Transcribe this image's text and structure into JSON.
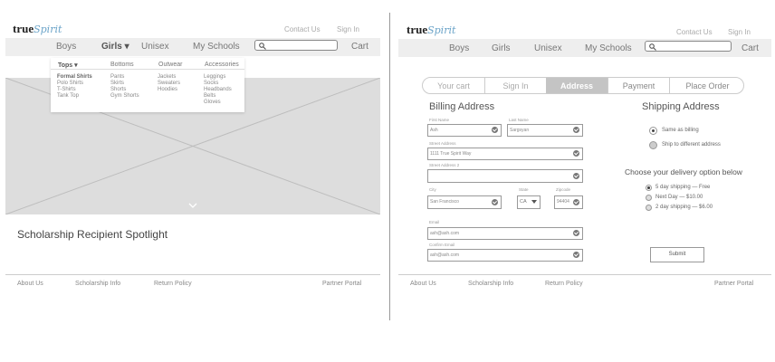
{
  "left": {
    "brand": {
      "word": "true",
      "script": "Spirit"
    },
    "top_links": {
      "contact": "Contact Us",
      "signin": "Sign In"
    },
    "nav": {
      "boys": "Boys",
      "girls": "Girls ▾",
      "unisex": "Unisex",
      "schools": "My Schools",
      "cart": "Cart"
    },
    "dropdown": {
      "headers": [
        "Tops  ▾",
        "Bottoms",
        "Outwear",
        "Accessories"
      ],
      "tops": [
        "Formal Shirts",
        "Polo Shirts",
        "T-Shirts",
        "Tank Top"
      ],
      "bottoms": [
        "Pants",
        "Skirts",
        "Shorts",
        "Gym Shorts"
      ],
      "outwear": [
        "Jackets",
        "Sweaters",
        "Hoodies"
      ],
      "accessories": [
        "Leggings",
        "Socks",
        "Headbands",
        "Belts",
        "Gloves"
      ]
    },
    "spotlight": "Scholarship Recipient Spotlight",
    "footer": {
      "about": "About Us",
      "scholarship": "Scholarship Info",
      "returns": "Return Policy",
      "partner": "Partner Portal"
    }
  },
  "right": {
    "brand": {
      "word": "true",
      "script": "Spirit"
    },
    "top_links": {
      "contact": "Contact Us",
      "signin": "Sign In"
    },
    "nav": {
      "boys": "Boys",
      "girls": "Girls",
      "unisex": "Unisex",
      "schools": "My Schools",
      "cart": "Cart"
    },
    "steps": [
      "Your cart",
      "Sign In",
      "Address",
      "Payment",
      "Place Order"
    ],
    "billing": {
      "title": "Billing Address",
      "first_label": "First Name",
      "first_value": "Ash",
      "last_label": "Last Name",
      "last_value": "Sargsyan",
      "street_label": "Street Address",
      "street_value": "1111 True Spirit Way",
      "street2_label": "Street Address 2",
      "street2_value": "",
      "city_label": "City",
      "city_value": "San Francisco",
      "state_label": "State",
      "state_value": "CA",
      "zip_label": "Zipcode",
      "zip_value": "94404",
      "email_label": "Email",
      "email_value": "ash@ash.com",
      "confirm_label": "Confirm Email",
      "confirm_value": "ash@ash.com"
    },
    "shipping": {
      "title": "Shipping Address",
      "same": "Same as billing",
      "different": "Ship to different address",
      "delivery_title": "Choose your delivery option below",
      "options": [
        "5 day shipping — Free",
        "Next Day — $10.00",
        "2 day shipping — $6.00"
      ],
      "submit": "Submit"
    },
    "footer": {
      "about": "About Us",
      "scholarship": "Scholarship Info",
      "returns": "Return Policy",
      "partner": "Partner Portal"
    }
  },
  "colors": {
    "nav_bg": "#eeeeee",
    "hero_bg": "#dddddd",
    "active_step": "#c4c4c4",
    "brand_script": "#6aa3c8"
  },
  "icons": {
    "search": "search-icon",
    "chevron": "chevron-down-icon",
    "check": "check-icon"
  }
}
